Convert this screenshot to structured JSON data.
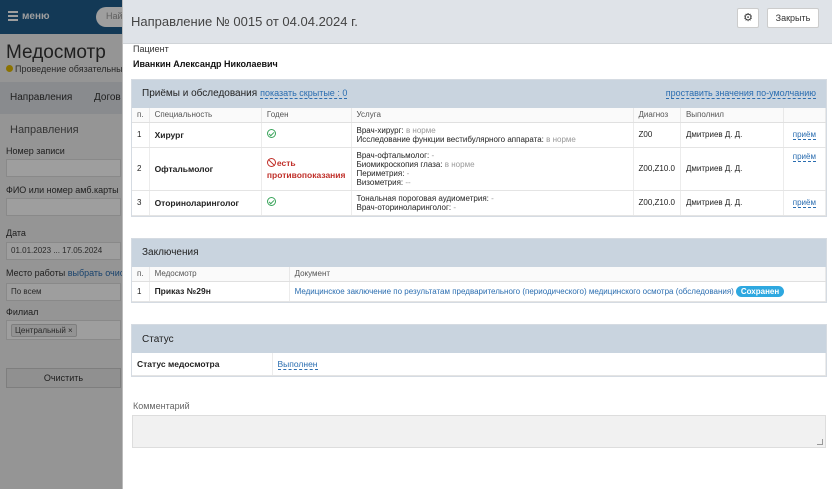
{
  "background": {
    "menu_label": "меню",
    "search_placeholder": "Най",
    "page_title": "Медосмотр",
    "page_subtitle": "Проведение обязательны",
    "tabs": [
      "Направления",
      "Догов"
    ],
    "section_title": "Направления",
    "fields": {
      "record_number_label": "Номер записи",
      "fio_label": "ФИО или номер амб.карты",
      "date_label": "Дата",
      "date_value": "01.01.2023 ... 17.05.2024",
      "workplace_label": "Место работы",
      "workplace_link": "выбрать очист",
      "workplace_value": "По всем",
      "branch_label": "Филиал",
      "branch_chip": "Центральный",
      "clear_button": "Очистить"
    }
  },
  "modal": {
    "title": "Направление № 0015 от 04.04.2024 г.",
    "gear_icon": "gear-icon",
    "close_label": "Закрыть",
    "patient_label": "Пациент",
    "patient_name": "Иванкин Александр Николаевич",
    "exams": {
      "title": "Приёмы и обследования",
      "hidden_link": "показать скрытые : 0",
      "defaults_link": "проставить значения по-умолчанию",
      "columns": [
        "п.",
        "Специальность",
        "Годен",
        "Услуга",
        "Диагноз",
        "Выполнил",
        ""
      ],
      "rows": [
        {
          "num": "1",
          "specialty": "Хирург",
          "fit": "ok",
          "services": [
            {
              "name": "Врач-хирург:",
              "result": "в норме"
            },
            {
              "name": "Исследование функции вестибулярного аппарата:",
              "result": "в норме"
            }
          ],
          "diagnosis": "Z00",
          "performer": "Дмитриев Д. Д.",
          "action": "приём"
        },
        {
          "num": "2",
          "specialty": "Офтальмолог",
          "fit": "contra",
          "fit_text": "есть противопоказания",
          "services": [
            {
              "name": "Врач-офтальмолог:",
              "result": "-"
            },
            {
              "name": "Биомикроскопия глаза:",
              "result": "в норме"
            },
            {
              "name": "Периметрия:",
              "result": "-"
            },
            {
              "name": "Визометрия:",
              "result": "--"
            }
          ],
          "diagnosis": "Z00,Z10.0",
          "performer": "Дмитриев Д. Д.",
          "action": "приём"
        },
        {
          "num": "3",
          "specialty": "Оториноларинголог",
          "fit": "ok",
          "services": [
            {
              "name": "Тональная пороговая аудиометрия:",
              "result": "-"
            },
            {
              "name": "Врач-оториноларинголог:",
              "result": "-"
            }
          ],
          "diagnosis": "Z00,Z10.0",
          "performer": "Дмитриев Д. Д.",
          "action": "приём"
        }
      ]
    },
    "conclusions": {
      "title": "Заключения",
      "columns": [
        "п.",
        "Медосмотр",
        "Документ"
      ],
      "rows": [
        {
          "num": "1",
          "order": "Приказ №29н",
          "document": "Медицинское заключение по результатам предварительного (периодического) медицинского осмотра (обследования)",
          "badge": "Сохранен"
        }
      ]
    },
    "status": {
      "title": "Статус",
      "label": "Статус медосмотра",
      "value": "Выполнен"
    },
    "comment_label": "Комментарий"
  }
}
